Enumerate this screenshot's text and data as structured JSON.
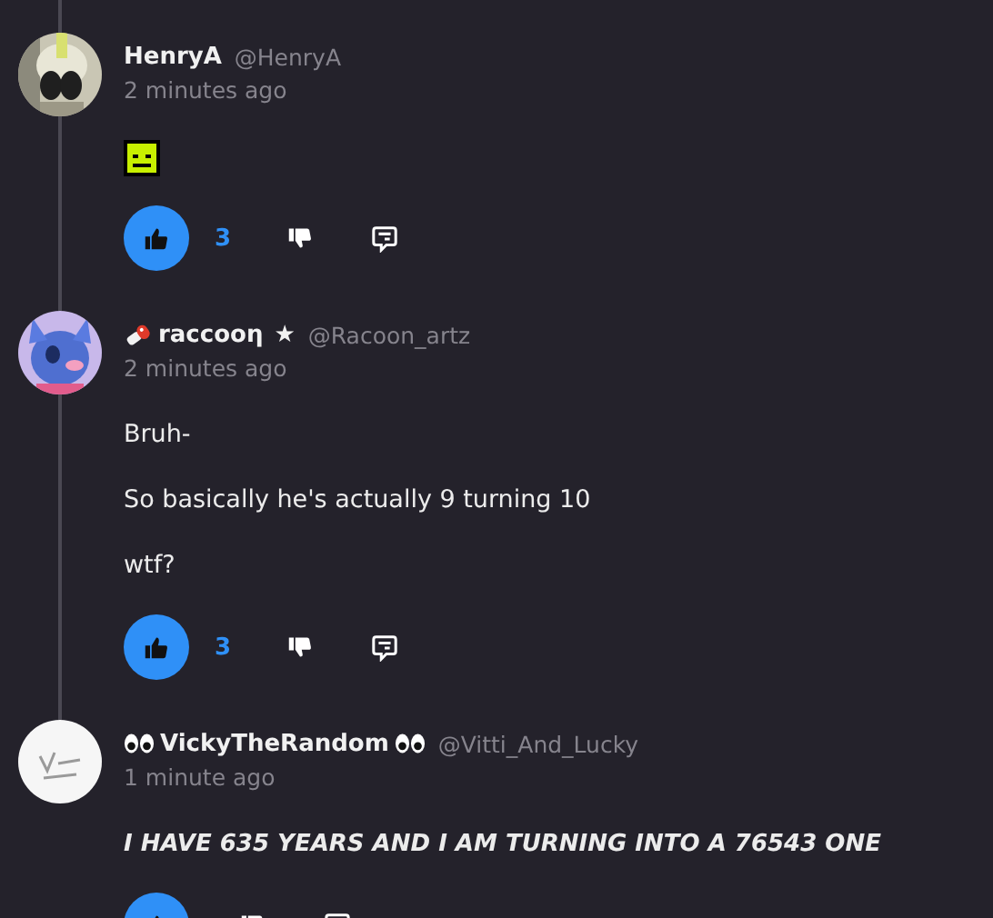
{
  "comments": [
    {
      "kind": "plain",
      "author": "HenryA",
      "handle": "@HenryA",
      "time": "2 minutes ago",
      "body": [
        {
          "kind": "sticker"
        }
      ],
      "likes": "3",
      "liked": true
    },
    {
      "kind": "meat",
      "author": "raccooη",
      "star": "★",
      "handle": "@Racoon_artz",
      "time": "2 minutes ago",
      "body": [
        {
          "kind": "text",
          "text": "Bruh-"
        },
        {
          "kind": "text",
          "text": "So basically he's actually 9 turning 10"
        },
        {
          "kind": "text",
          "text": "wtf?"
        }
      ],
      "likes": "3",
      "liked": true
    },
    {
      "kind": "eyes",
      "author": "VickyTheRandom",
      "handle": "@Vitti_And_Lucky",
      "time": "1 minute ago",
      "body": [
        {
          "kind": "shout",
          "text": "I HAVE 635 YEARS AND I AM TURNING INTO A 76543 ONE"
        }
      ],
      "liked": true
    }
  ]
}
